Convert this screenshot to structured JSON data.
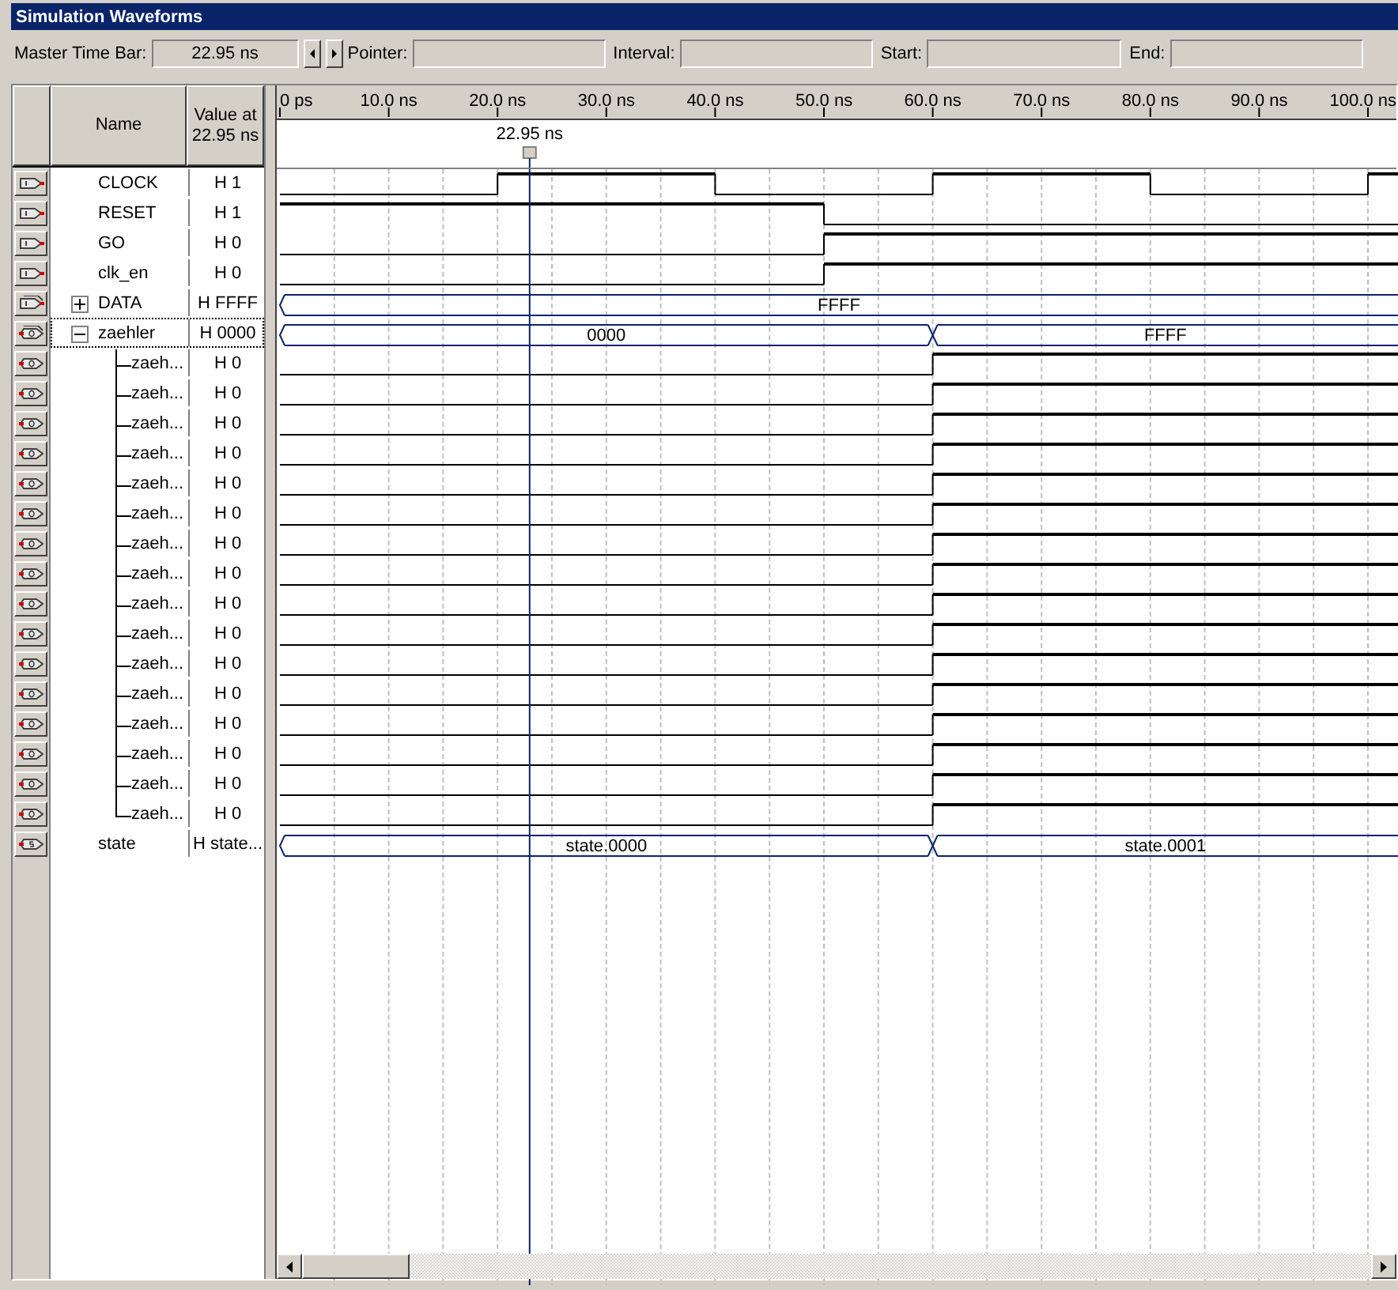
{
  "window": {
    "title": "Simulation Waveforms"
  },
  "toolbar": {
    "master_time_bar": {
      "label": "Master Time Bar:",
      "value": "22.95 ns"
    },
    "pointer": {
      "label": "Pointer:"
    },
    "interval": {
      "label": "Interval:"
    },
    "start": {
      "label": "Start:"
    },
    "end": {
      "label": "End:"
    }
  },
  "columns": {
    "name": "Name",
    "value": "Value at 22.95 ns"
  },
  "ruler": [
    "0 ps",
    "10.0 ns",
    "20.0 ns",
    "30.0 ns",
    "40.0 ns",
    "50.0 ns",
    "60.0 ns",
    "70.0 ns",
    "80.0 ns",
    "90.0 ns",
    "100.0 ns"
  ],
  "cursor": {
    "label": "22.95 ns"
  },
  "signals": [
    {
      "name": "CLOCK",
      "value": "H 1",
      "kind": "input",
      "selected": false
    },
    {
      "name": "RESET",
      "value": "H 1",
      "kind": "input",
      "selected": false
    },
    {
      "name": "GO",
      "value": "H 0",
      "kind": "input",
      "selected": false
    },
    {
      "name": "clk_en",
      "value": "H 0",
      "kind": "input",
      "selected": false
    },
    {
      "name": "DATA",
      "value": "H FFFF",
      "kind": "input-bus",
      "expanded": false,
      "selected": false,
      "segments": [
        "FFFF"
      ]
    },
    {
      "name": "zaehler",
      "value": "H 0000",
      "kind": "output-bus",
      "expanded": true,
      "selected": true,
      "segments": [
        "0000",
        "FFFF"
      ],
      "children": [
        {
          "name": "zaeh...",
          "value": "H 0",
          "kind": "output",
          "selected": false
        },
        {
          "name": "zaeh...",
          "value": "H 0",
          "kind": "output",
          "selected": false
        },
        {
          "name": "zaeh...",
          "value": "H 0",
          "kind": "output",
          "selected": false
        },
        {
          "name": "zaeh...",
          "value": "H 0",
          "kind": "output",
          "selected": false
        },
        {
          "name": "zaeh...",
          "value": "H 0",
          "kind": "output",
          "selected": false
        },
        {
          "name": "zaeh...",
          "value": "H 0",
          "kind": "output",
          "selected": false
        },
        {
          "name": "zaeh...",
          "value": "H 0",
          "kind": "output",
          "selected": false
        },
        {
          "name": "zaeh...",
          "value": "H 0",
          "kind": "output",
          "selected": false
        },
        {
          "name": "zaeh...",
          "value": "H 0",
          "kind": "output",
          "selected": false
        },
        {
          "name": "zaeh...",
          "value": "H 0",
          "kind": "output",
          "selected": false
        },
        {
          "name": "zaeh...",
          "value": "H 0",
          "kind": "output",
          "selected": false
        },
        {
          "name": "zaeh...",
          "value": "H 0",
          "kind": "output",
          "selected": false
        },
        {
          "name": "zaeh...",
          "value": "H 0",
          "kind": "output",
          "selected": false
        },
        {
          "name": "zaeh...",
          "value": "H 0",
          "kind": "output",
          "selected": false
        },
        {
          "name": "zaeh...",
          "value": "H 0",
          "kind": "output",
          "selected": false
        },
        {
          "name": "zaeh...",
          "value": "H 0",
          "kind": "output",
          "selected": false
        }
      ]
    },
    {
      "name": "state",
      "value": "H state...",
      "kind": "state",
      "selected": false,
      "segments": [
        "state.0000",
        "state.0001"
      ]
    }
  ]
}
